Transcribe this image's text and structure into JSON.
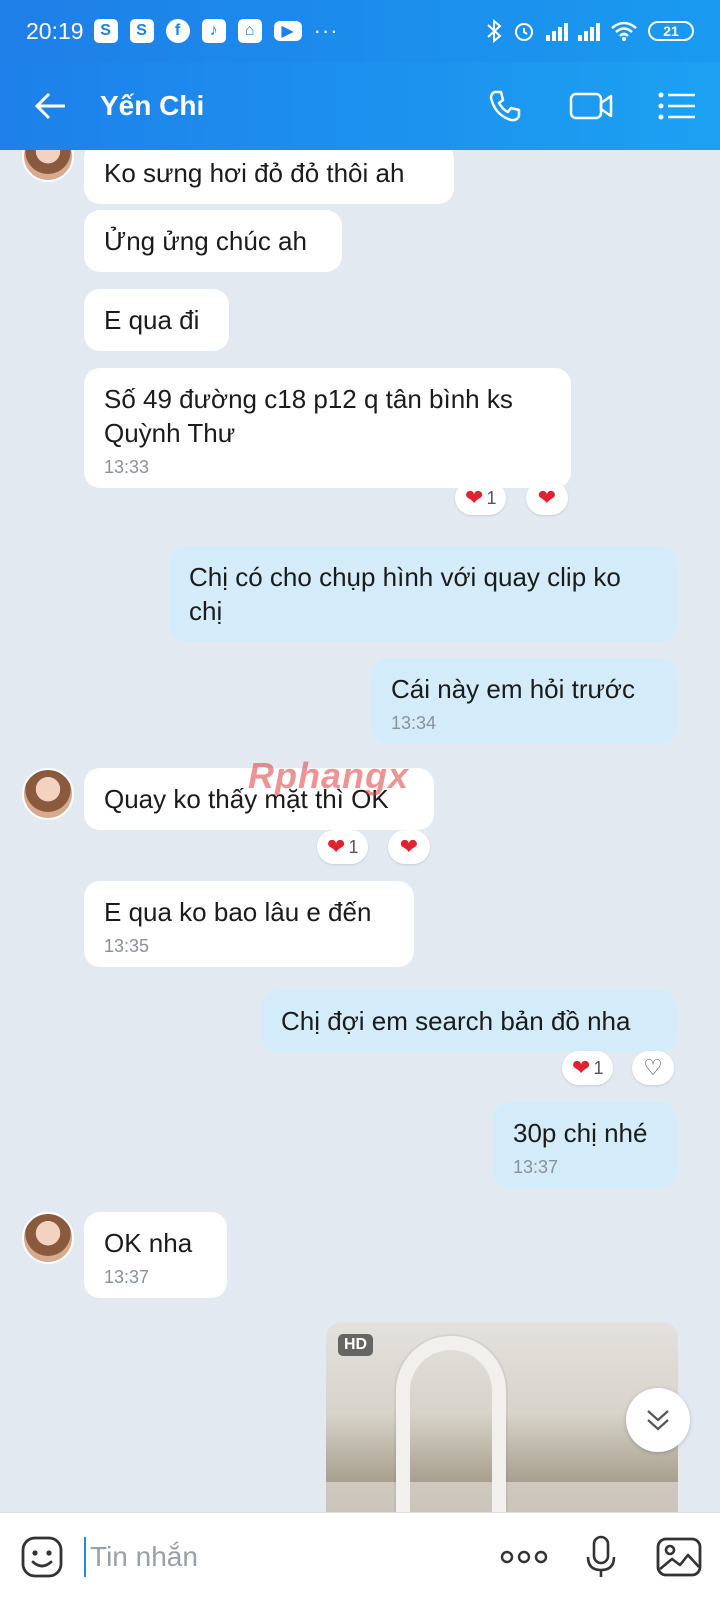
{
  "status_bar": {
    "time": "20:19",
    "battery": "21"
  },
  "header": {
    "contact_name": "Yến Chi"
  },
  "watermark": "Rphangx",
  "messages": [
    {
      "text": "Ko sưng hơi đỏ đỏ thôi ah"
    },
    {
      "text": "Ửng ửng chúc ah"
    },
    {
      "text": "E qua đi"
    },
    {
      "text": "Số 49 đường c18 p12 q tân bình ks Quỳnh Thư",
      "time": "13:33",
      "reaction_count": "1"
    },
    {
      "text": "Chị có cho chụp hình với quay clip ko chị"
    },
    {
      "text": "Cái này em hỏi trước",
      "time": "13:34"
    },
    {
      "text": "Quay ko thấy mặt thì OK",
      "reaction_count": "1"
    },
    {
      "text": "E qua ko bao lâu e đến",
      "time": "13:35"
    },
    {
      "text": "Chị đợi em search bản đồ nha",
      "reaction_count": "1"
    },
    {
      "text": "30p chị nhé",
      "time": "13:37"
    },
    {
      "text": "OK nha",
      "time": "13:37"
    }
  ],
  "media": {
    "badge": "HD"
  },
  "input": {
    "placeholder": "Tin nhắn"
  },
  "icons": [
    "back-arrow-icon",
    "phone-icon",
    "video-call-icon",
    "menu-icon",
    "heart-icon",
    "chevron-down-icon",
    "sticker-icon",
    "more-icon",
    "microphone-icon",
    "image-icon"
  ],
  "colors": {
    "header": "#1d80ea",
    "incoming_bubble": "#ffffff",
    "outgoing_bubble": "#d4ecfa",
    "chat_background": "#e2e9f1",
    "heart": "#e0242f"
  }
}
